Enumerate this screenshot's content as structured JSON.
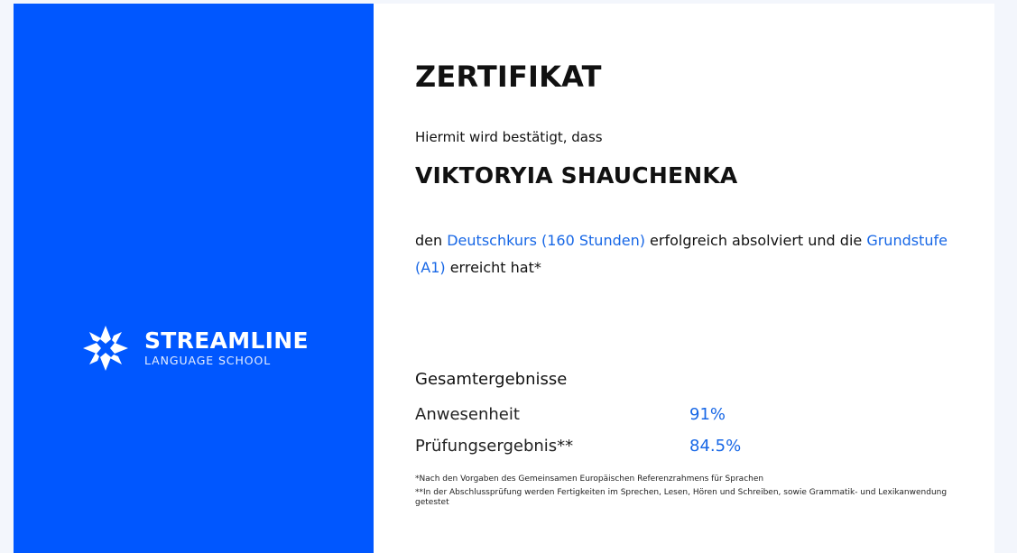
{
  "brand": {
    "name": "STREAMLINE",
    "subtitle": "LANGUAGE SCHOOL",
    "logo_icon": "star-compass-icon"
  },
  "certificate": {
    "title": "ZERTIFIKAT",
    "intro": "Hiermit wird bestätigt, dass",
    "recipient": "VIKTORYIA SHAUCHENKA",
    "statement": {
      "prefix": "den ",
      "course": "Deutschkurs (160 Stunden)",
      "middle": " erfolgreich absolviert und die ",
      "level": "Grundstufe (A1)",
      "suffix": " erreicht hat*"
    },
    "results": {
      "title": "Gesamtergebnisse",
      "rows": [
        {
          "label": "Anwesenheit",
          "value": "91%"
        },
        {
          "label": "Prüfungsergebnis**",
          "value": "84.5%"
        }
      ]
    },
    "footnotes": [
      "*Nach den Vorgaben des Gemeinsamen Europäischen Referenzrahmens für Sprachen",
      "**In der Abschlussprüfung werden Fertigkeiten im Sprechen, Lesen, Hören und Schreiben, sowie Grammatik- und Lexikanwendung getestet"
    ]
  },
  "colors": {
    "brand_blue": "#0057ff",
    "accent_text": "#1767e6",
    "background": "#f3f6fc"
  }
}
